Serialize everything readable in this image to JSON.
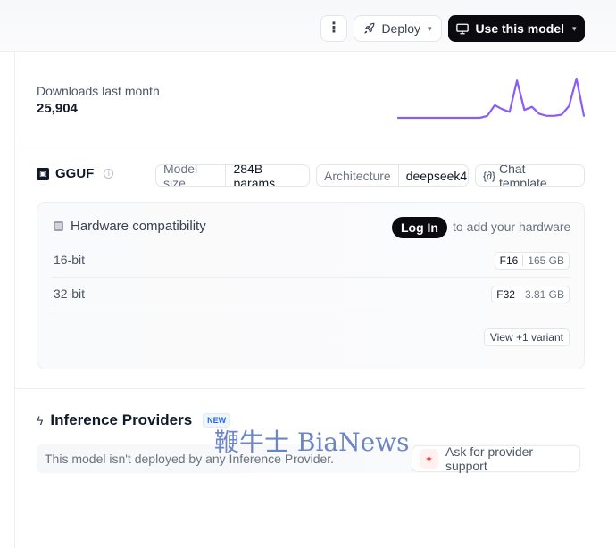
{
  "header": {
    "deploy_label": "Deploy",
    "use_model_label": "Use this model"
  },
  "downloads": {
    "label": "Downloads last month",
    "value": "25,904",
    "trend": [
      0,
      0,
      0,
      0,
      0,
      0,
      0,
      0,
      0,
      0,
      0,
      0,
      0.05,
      0.32,
      0.22,
      0.15,
      0.95,
      0.2,
      0.28,
      0.1,
      0.05,
      0.05,
      0.08,
      0.3,
      1.0,
      0.05
    ],
    "trend_color": "#8b5cf6"
  },
  "gguf": {
    "title": "GGUF",
    "model_size_key": "Model size",
    "model_size_value": "284B params",
    "architecture_key": "Architecture",
    "architecture_value": "deepseek4",
    "chat_template_label": "Chat template"
  },
  "hardware": {
    "title": "Hardware compatibility",
    "login_label": "Log In",
    "login_hint": "to add your hardware",
    "rows": [
      {
        "label": "16-bit",
        "quant": "F16",
        "size": "165 GB"
      },
      {
        "label": "32-bit",
        "quant": "F32",
        "size": "3.81 GB"
      }
    ],
    "variant_label": "View +1 variant"
  },
  "inference": {
    "title": "Inference Providers",
    "badge": "NEW",
    "message": "This model isn't deployed by any Inference Provider.",
    "support_label": "Ask for provider support"
  },
  "watermark": {
    "text": "鞭牛士 BiaNews"
  }
}
